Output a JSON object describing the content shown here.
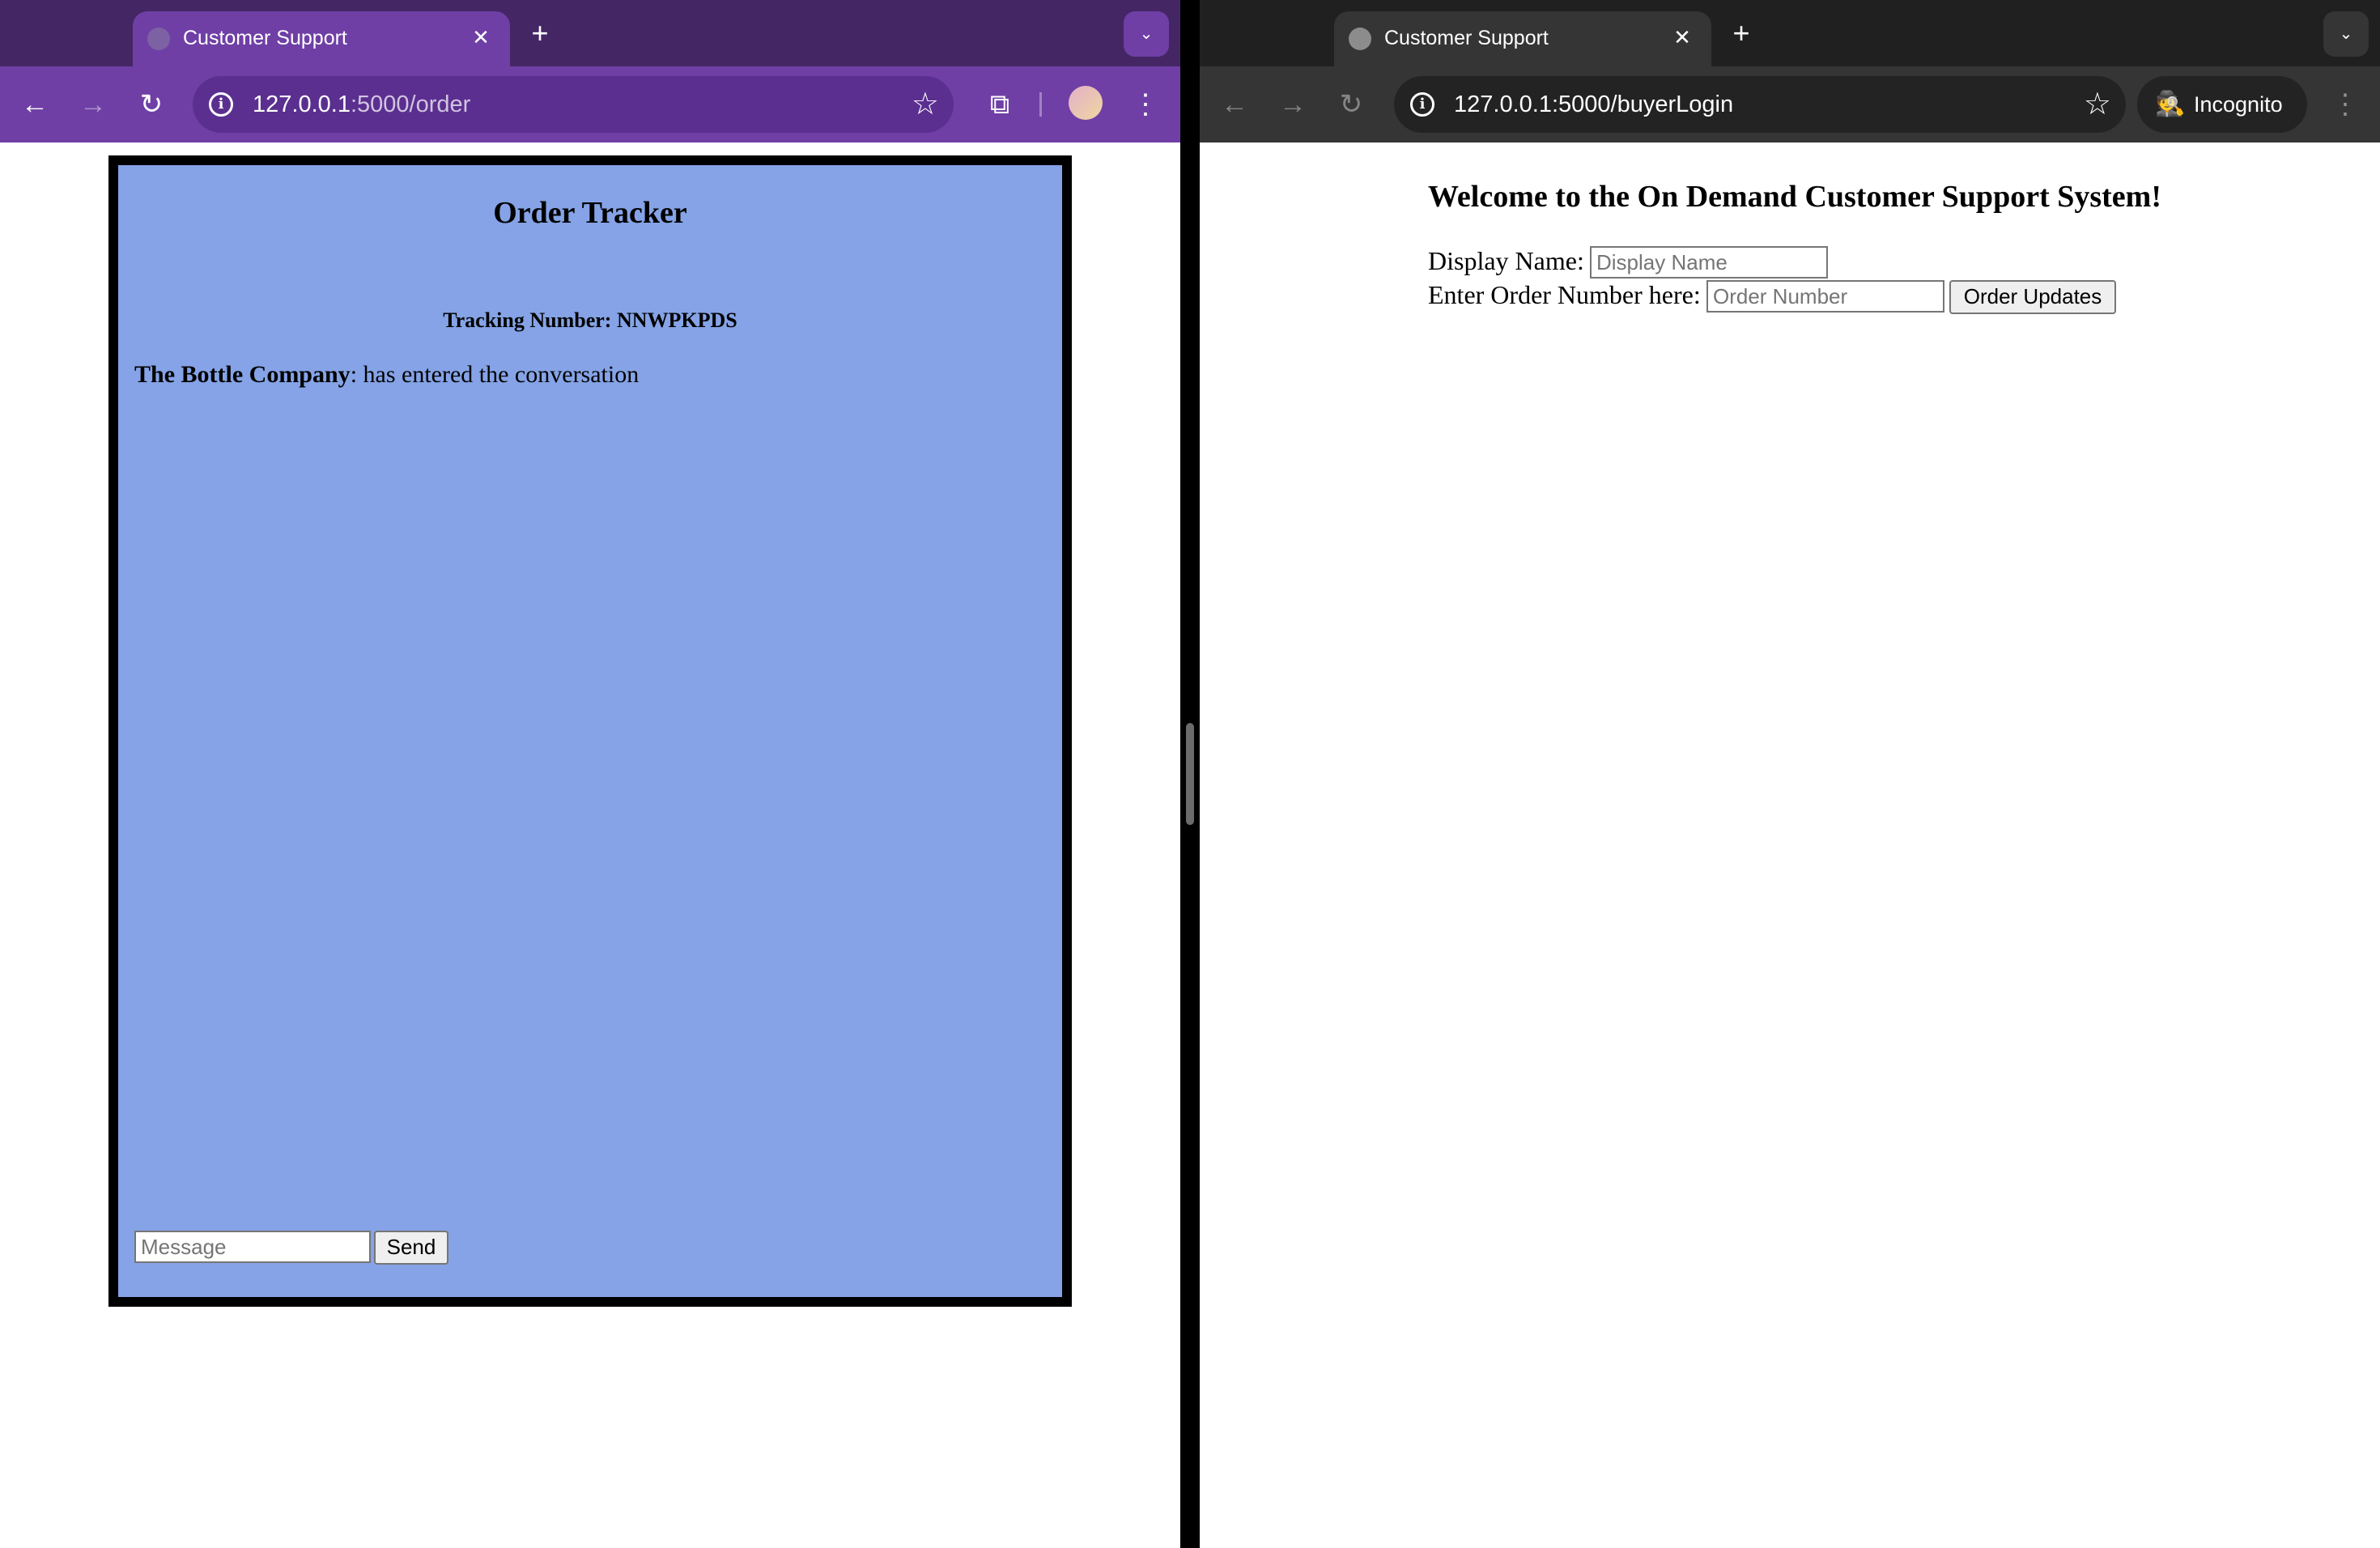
{
  "left_window": {
    "tab": {
      "title": "Customer Support",
      "close": "✕"
    },
    "new_tab": "+",
    "tab_menu": "⌄",
    "nav": {
      "back": "←",
      "forward": "→",
      "reload": "↻"
    },
    "omnibox": {
      "host": "127.0.0.1",
      "path": ":5000/order",
      "info": "i",
      "star": "☆"
    },
    "extensions": "⧉",
    "menu": "⋮",
    "page": {
      "title": "Order Tracker",
      "tracking_label": "Tracking Number: ",
      "tracking_number": "NNWPKPDS",
      "messages": [
        {
          "sender": "The Bottle Company",
          "text": ": has entered the conversation"
        }
      ],
      "message_placeholder": "Message",
      "send_label": "Send",
      "panel_color": "#85a3e6"
    },
    "theme_colors": {
      "tabbar": "#452665",
      "toolbar": "#6f3fa6"
    }
  },
  "right_window": {
    "tab": {
      "title": "Customer Support",
      "close": "✕"
    },
    "new_tab": "+",
    "tab_menu": "⌄",
    "nav": {
      "back": "←",
      "forward": "→",
      "reload": "↻"
    },
    "omnibox": {
      "host": "127.0.0.1",
      "path": ":5000/buyerLogin",
      "info": "i",
      "star": "☆"
    },
    "incognito": {
      "icon": "🕵",
      "label": "Incognito"
    },
    "menu": "⋮",
    "page": {
      "welcome": "Welcome to the On Demand Customer Support System!",
      "display_name_label": "Display Name:",
      "display_name_placeholder": "Display Name",
      "order_number_label": "Enter Order Number here:",
      "order_number_placeholder": "Order Number",
      "order_updates_label": "Order Updates"
    },
    "theme_colors": {
      "tabbar": "#202020",
      "toolbar": "#353535"
    }
  }
}
